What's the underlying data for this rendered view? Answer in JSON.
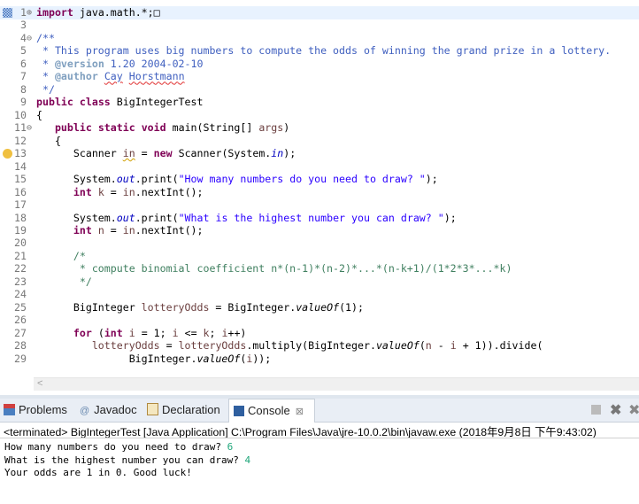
{
  "editor": {
    "lines": [
      {
        "n": "1",
        "fold": "⊕",
        "cur": true,
        "seg": [
          [
            "kw",
            "import"
          ],
          [
            "",
            "java.math.*;"
          ],
          [
            "",
            "□"
          ]
        ]
      },
      {
        "n": "3",
        "seg": []
      },
      {
        "n": "4",
        "fold": "⊖",
        "seg": [
          [
            "doc",
            "/**"
          ]
        ]
      },
      {
        "n": "5",
        "seg": [
          [
            "doc",
            " * This program uses big numbers to compute the odds of winning the grand prize in a lottery."
          ]
        ]
      },
      {
        "n": "6",
        "seg": [
          [
            "doc",
            " * "
          ],
          [
            "tag",
            "@version"
          ],
          [
            "doc",
            " 1.20 2004-02-10"
          ]
        ]
      },
      {
        "n": "7",
        "seg": [
          [
            "doc",
            " * "
          ],
          [
            "tag",
            "@author"
          ],
          [
            "doc",
            " "
          ],
          [
            "doc sp",
            "Cay"
          ],
          [
            "doc",
            " "
          ],
          [
            "doc sp",
            "Horstmann"
          ]
        ]
      },
      {
        "n": "8",
        "seg": [
          [
            "doc",
            " */"
          ]
        ]
      },
      {
        "n": "9",
        "seg": [
          [
            "kw",
            "public"
          ],
          [
            "",
            " "
          ],
          [
            "kw",
            "class"
          ],
          [
            "",
            " BigIntegerTest"
          ]
        ]
      },
      {
        "n": "10",
        "seg": [
          [
            "",
            "{"
          ]
        ]
      },
      {
        "n": "11",
        "fold": "⊖",
        "seg": [
          [
            "",
            "   "
          ],
          [
            "kw",
            "public"
          ],
          [
            "",
            " "
          ],
          [
            "kw",
            "static"
          ],
          [
            "",
            " "
          ],
          [
            "kw",
            "void"
          ],
          [
            "",
            " main(String[] "
          ],
          [
            "loc",
            "args"
          ],
          [
            "",
            ")"
          ]
        ]
      },
      {
        "n": "12",
        "seg": [
          [
            "",
            "   {"
          ]
        ]
      },
      {
        "n": "13",
        "warn": true,
        "seg": [
          [
            "",
            "      Scanner "
          ],
          [
            "loc warn-u",
            "in"
          ],
          [
            "",
            " = "
          ],
          [
            "kw",
            "new"
          ],
          [
            "",
            " Scanner(System."
          ],
          [
            "sf",
            "in"
          ],
          [
            "",
            ");"
          ]
        ]
      },
      {
        "n": "14",
        "seg": []
      },
      {
        "n": "15",
        "seg": [
          [
            "",
            "      System."
          ],
          [
            "sf",
            "out"
          ],
          [
            "",
            ".print("
          ],
          [
            "str",
            "\"How many numbers do you need to draw? \""
          ],
          [
            "",
            ");"
          ]
        ]
      },
      {
        "n": "16",
        "seg": [
          [
            "",
            "      "
          ],
          [
            "kw",
            "int"
          ],
          [
            "",
            " "
          ],
          [
            "loc",
            "k"
          ],
          [
            "",
            " = "
          ],
          [
            "loc",
            "in"
          ],
          [
            "",
            ".nextInt();"
          ]
        ]
      },
      {
        "n": "17",
        "seg": []
      },
      {
        "n": "18",
        "seg": [
          [
            "",
            "      System."
          ],
          [
            "sf",
            "out"
          ],
          [
            "",
            ".print("
          ],
          [
            "str",
            "\"What is the highest number you can draw? \""
          ],
          [
            "",
            ");"
          ]
        ]
      },
      {
        "n": "19",
        "seg": [
          [
            "",
            "      "
          ],
          [
            "kw",
            "int"
          ],
          [
            "",
            " "
          ],
          [
            "loc",
            "n"
          ],
          [
            "",
            " = "
          ],
          [
            "loc",
            "in"
          ],
          [
            "",
            ".nextInt();"
          ]
        ]
      },
      {
        "n": "20",
        "seg": []
      },
      {
        "n": "21",
        "seg": [
          [
            "cmt",
            "      /*"
          ]
        ]
      },
      {
        "n": "22",
        "seg": [
          [
            "cmt",
            "       * compute binomial coefficient n*(n-1)*(n-2)*...*(n-k+1)/(1*2*3*...*k)"
          ]
        ]
      },
      {
        "n": "23",
        "seg": [
          [
            "cmt",
            "       */"
          ]
        ]
      },
      {
        "n": "24",
        "seg": []
      },
      {
        "n": "25",
        "seg": [
          [
            "",
            "      BigInteger "
          ],
          [
            "loc",
            "lotteryOdds"
          ],
          [
            "",
            " = BigInteger."
          ],
          [
            "sm",
            "valueOf"
          ],
          [
            "",
            "(1);"
          ]
        ]
      },
      {
        "n": "26",
        "seg": []
      },
      {
        "n": "27",
        "seg": [
          [
            "",
            "      "
          ],
          [
            "kw",
            "for"
          ],
          [
            "",
            " ("
          ],
          [
            "kw",
            "int"
          ],
          [
            "",
            " "
          ],
          [
            "loc",
            "i"
          ],
          [
            "",
            " = 1; "
          ],
          [
            "loc",
            "i"
          ],
          [
            "",
            " <= "
          ],
          [
            "loc",
            "k"
          ],
          [
            "",
            "; "
          ],
          [
            "loc",
            "i"
          ],
          [
            "",
            "++)"
          ]
        ]
      },
      {
        "n": "28",
        "seg": [
          [
            "",
            "         "
          ],
          [
            "loc",
            "lotteryOdds"
          ],
          [
            "",
            " = "
          ],
          [
            "loc",
            "lotteryOdds"
          ],
          [
            "",
            ".multiply(BigInteger."
          ],
          [
            "sm",
            "valueOf"
          ],
          [
            "",
            "("
          ],
          [
            "loc",
            "n"
          ],
          [
            "",
            " - "
          ],
          [
            "loc",
            "i"
          ],
          [
            "",
            " + 1)).divide("
          ]
        ]
      },
      {
        "n": "29",
        "seg": [
          [
            "",
            "               BigInteger."
          ],
          [
            "sm",
            "valueOf"
          ],
          [
            "",
            "("
          ],
          [
            "loc",
            "i"
          ],
          [
            "",
            "));"
          ]
        ]
      }
    ],
    "scroll_left": "<"
  },
  "tabs": [
    {
      "label": "Problems",
      "icon": "problems-icon"
    },
    {
      "label": "Javadoc",
      "icon": "at-icon",
      "glyph": "@"
    },
    {
      "label": "Declaration",
      "icon": "declaration-icon"
    },
    {
      "label": "Console",
      "icon": "console-icon",
      "active": true,
      "close": "⊠"
    }
  ],
  "console": {
    "status": "<terminated> BigIntegerTest [Java Application] C:\\Program Files\\Java\\jre-10.0.2\\bin\\javaw.exe (2018年9月8日 下午9:43:02)",
    "output": [
      {
        "text": "How many numbers do you need to draw? ",
        "input": "6"
      },
      {
        "text": "What is the highest number you can draw? ",
        "input": "4"
      },
      {
        "text": "Your odds are 1 in 0. Good luck!",
        "input": ""
      }
    ]
  }
}
